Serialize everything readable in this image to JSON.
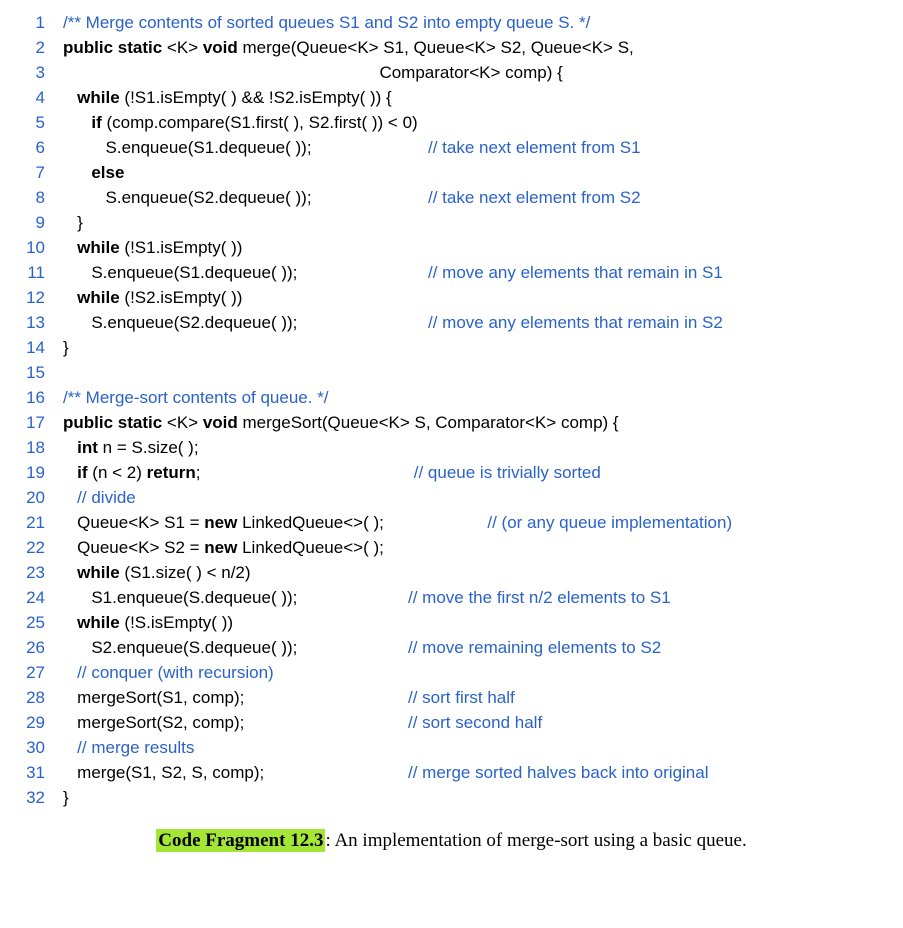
{
  "lineNumbers": [
    "1",
    "2",
    "3",
    "4",
    "5",
    "6",
    "7",
    "8",
    "9",
    "10",
    "11",
    "12",
    "13",
    "14",
    "15",
    "16",
    "17",
    "18",
    "19",
    "20",
    "21",
    "22",
    "23",
    "24",
    "25",
    "26",
    "27",
    "28",
    "29",
    "30",
    "31",
    "32"
  ],
  "lines": {
    "l1_comment": "/** Merge contents of sorted queues S1 and S2 into empty queue S. */",
    "l2_kw1": "public static",
    "l2_mid": " <K> ",
    "l2_kw2": "void",
    "l2_rest": " merge(Queue<K> S1, Queue<K> S2, Queue<K> S,",
    "l3": "                                                                   Comparator<K> comp) {",
    "l4_kw": "while",
    "l4_rest": " (!S1.isEmpty( ) && !S2.isEmpty( )) {",
    "l5_kw": "if",
    "l5_rest": " (comp.compare(S1.first( ), S2.first( )) < 0)",
    "l6_code": "         S.enqueue(S1.dequeue( ));",
    "l6_comment": "// take next element from S1",
    "l7_kw": "else",
    "l8_code": "         S.enqueue(S2.dequeue( ));",
    "l8_comment": "// take next element from S2",
    "l9": "   }",
    "l10_kw": "while",
    "l10_rest": " (!S1.isEmpty( ))",
    "l11_code": "      S.enqueue(S1.dequeue( ));",
    "l11_comment": "// move any elements that remain in S1",
    "l12_kw": "while",
    "l12_rest": " (!S2.isEmpty( ))",
    "l13_code": "      S.enqueue(S2.dequeue( ));",
    "l13_comment": "// move any elements that remain in S2",
    "l14": "}",
    "l15": "",
    "l16_comment": "/** Merge-sort contents of queue. */",
    "l17_kw1": "public static",
    "l17_mid": " <K> ",
    "l17_kw2": "void",
    "l17_rest": " mergeSort(Queue<K> S, Comparator<K> comp) {",
    "l18_kw": "int",
    "l18_rest": " n = S.size( );",
    "l19_kw1": "if",
    "l19_mid": " (n < 2) ",
    "l19_kw2": "return",
    "l19_rest": ";",
    "l19_comment": "// queue is trivially sorted",
    "l20_comment": "// divide",
    "l21_pre": "   Queue<K> S1 = ",
    "l21_kw": "new",
    "l21_post": " LinkedQueue<>( );",
    "l21_comment": "// (or any queue implementation)",
    "l22_pre": "   Queue<K> S2 = ",
    "l22_kw": "new",
    "l22_post": " LinkedQueue<>( );",
    "l23_kw": "while",
    "l23_rest": " (S1.size( ) < n/2)",
    "l24_code": "      S1.enqueue(S.dequeue( ));",
    "l24_comment": "// move the first n/2 elements to S1",
    "l25_kw": "while",
    "l25_rest": " (!S.isEmpty( ))",
    "l26_code": "      S2.enqueue(S.dequeue( ));",
    "l26_comment": "// move remaining elements to S2",
    "l27_comment": "// conquer (with recursion)",
    "l28_code": "   mergeSort(S1, comp);",
    "l28_comment": "// sort first half",
    "l29_code": "   mergeSort(S2, comp);",
    "l29_comment": "// sort second half",
    "l30_comment": "// merge results",
    "l31_code": "   merge(S1, S2, S, comp);",
    "l31_comment": "// merge sorted halves back into original",
    "l32": "}"
  },
  "caption": {
    "label": "Code Fragment 12.3",
    "sep": ": ",
    "text": "An implementation of merge-sort using a basic queue."
  }
}
